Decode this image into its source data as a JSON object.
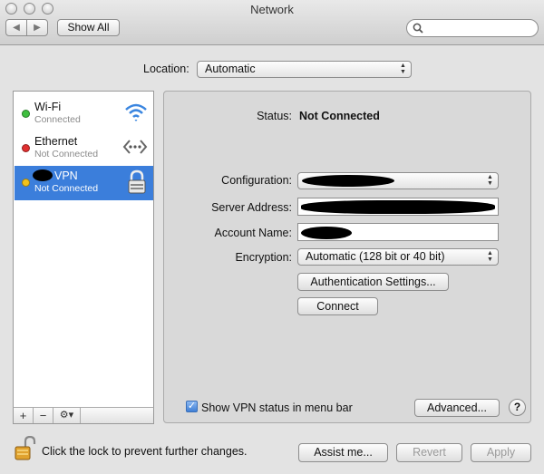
{
  "window": {
    "title": "Network"
  },
  "toolbar": {
    "show_all_label": "Show All",
    "search_placeholder": ""
  },
  "location": {
    "label": "Location:",
    "value": "Automatic"
  },
  "sidebar": {
    "services": [
      {
        "name": "Wi-Fi",
        "status": "Connected",
        "dot_color": "#3fbf3f",
        "icon": "wifi-icon"
      },
      {
        "name": "Ethernet",
        "status": "Not Connected",
        "dot_color": "#e03030",
        "icon": "ethernet-icon"
      },
      {
        "name": "VPN",
        "status": "Not Connected",
        "dot_color": "#f2c21b",
        "icon": "lock-icon"
      }
    ],
    "add_label": "+",
    "remove_label": "−",
    "action_label": "⚙▾"
  },
  "detail": {
    "status_label": "Status:",
    "status_value": "Not Connected",
    "configuration_label": "Configuration:",
    "server_address_label": "Server Address:",
    "account_name_label": "Account Name:",
    "encryption_label": "Encryption:",
    "encryption_value": "Automatic (128 bit or 40 bit)",
    "auth_settings_label": "Authentication Settings...",
    "connect_label": "Connect",
    "show_vpn_status_label": "Show VPN status in menu bar",
    "show_vpn_status_checked": true,
    "advanced_label": "Advanced...",
    "help_label": "?"
  },
  "footer": {
    "lock_text": "Click the lock to prevent further changes.",
    "assist_label": "Assist me...",
    "revert_label": "Revert",
    "apply_label": "Apply"
  },
  "colors": {
    "selection": "#3b7edb"
  }
}
